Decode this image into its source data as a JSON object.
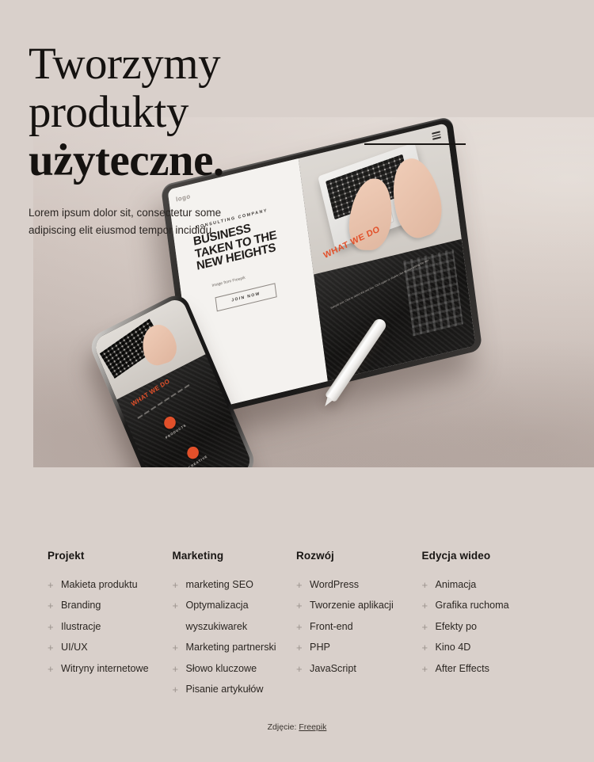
{
  "hero": {
    "headline_lines": [
      "Tworzymy",
      "produkty",
      "użyteczne."
    ],
    "subhead": "Lorem ipsum dolor sit, consectetur some adipiscing elit eiusmod tempor incididu",
    "divider": "horizontal-rule"
  },
  "mockup": {
    "tablet": {
      "logo": "logo",
      "eyebrow": "CONSULTING COMPANY",
      "headline": "BUSINESS\nTAKEN TO THE\nNEW HEIGHTS",
      "headline_line1": "BUSINESS",
      "headline_line2": "TAKEN TO THE",
      "headline_line3": "NEW HEIGHTS",
      "credit": "Image from Freepik",
      "cta": "JOIN NOW",
      "section_label": "WHAT WE DO",
      "section_body": "Sample text. Click to select the text box. Click again or double click to start editing the text."
    },
    "phone": {
      "section_label": "WHAT WE DO",
      "feature_1": "PRODUCTS",
      "feature_2": "CREATIVE"
    },
    "stylus": "stylus-pen"
  },
  "footer": {
    "columns": [
      {
        "title": "Projekt",
        "items": [
          {
            "label": "Makieta produktu",
            "marker": "+"
          },
          {
            "label": "Branding",
            "marker": "+"
          },
          {
            "label": "Ilustracje",
            "marker": "+"
          },
          {
            "label": "UI/UX",
            "marker": "+"
          },
          {
            "label": "Witryny internetowe",
            "marker": "+"
          }
        ]
      },
      {
        "title": "Marketing",
        "items": [
          {
            "label": "marketing SEO",
            "marker": "+"
          },
          {
            "label": "Optymalizacja",
            "marker": "+"
          },
          {
            "label": "wyszukiwarek",
            "marker": ""
          },
          {
            "label": "Marketing partnerski",
            "marker": "+"
          },
          {
            "label": "Słowo kluczowe",
            "marker": "+"
          },
          {
            "label": "Pisanie artykułów",
            "marker": "+"
          }
        ]
      },
      {
        "title": "Rozwój",
        "items": [
          {
            "label": "WordPress",
            "marker": "+"
          },
          {
            "label": "Tworzenie aplikacji",
            "marker": "+"
          },
          {
            "label": "Front-end",
            "marker": "+"
          },
          {
            "label": "PHP",
            "marker": "+"
          },
          {
            "label": "JavaScript",
            "marker": "+"
          }
        ]
      },
      {
        "title": "Edycja wideo",
        "items": [
          {
            "label": "Animacja",
            "marker": "+"
          },
          {
            "label": "Grafika ruchoma",
            "marker": "+"
          },
          {
            "label": "Efekty po",
            "marker": "+"
          },
          {
            "label": "Kino 4D",
            "marker": "+"
          },
          {
            "label": "After Effects",
            "marker": "+"
          }
        ]
      }
    ]
  },
  "credit": {
    "prefix": "Zdjęcie: ",
    "link": "Freepik"
  },
  "colors": {
    "background": "#d9d0cb",
    "text": "#2b2622",
    "heading": "#151210",
    "accent": "#e2502a",
    "muted": "#9b938d"
  }
}
